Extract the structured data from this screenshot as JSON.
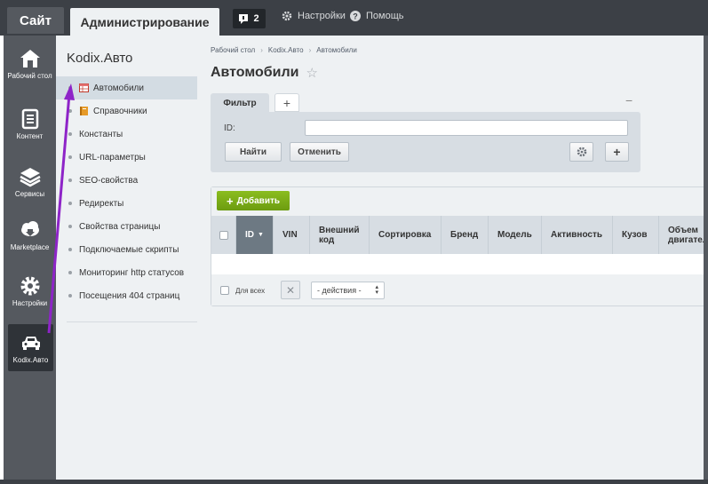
{
  "topbar": {
    "site_tab": "Сайт",
    "admin_tab": "Администрирование",
    "notifications_count": "2",
    "settings_label": "Настройки",
    "help_label": "Помощь"
  },
  "leftpanel": {
    "items": [
      {
        "label": "Рабочий стол",
        "icon": "home-icon"
      },
      {
        "label": "Контент",
        "icon": "document-icon"
      },
      {
        "label": "Сервисы",
        "icon": "layers-icon"
      },
      {
        "label": "Marketplace",
        "icon": "cloud-download-icon"
      },
      {
        "label": "Настройки",
        "icon": "gear-icon"
      },
      {
        "label": "Kodix.Авто",
        "icon": "car-icon"
      }
    ]
  },
  "menu": {
    "title": "Kodix.Авто",
    "items": [
      {
        "label": "Автомобили",
        "icon": "table-icon"
      },
      {
        "label": "Справочники",
        "icon": "book-icon"
      },
      {
        "label": "Константы"
      },
      {
        "label": "URL-параметры"
      },
      {
        "label": "SEO-свойства"
      },
      {
        "label": "Редиректы"
      },
      {
        "label": "Свойства страницы"
      },
      {
        "label": "Подключаемые скрипты"
      },
      {
        "label": "Мониторинг http статусов"
      },
      {
        "label": "Посещения 404 страниц"
      }
    ]
  },
  "breadcrumb": [
    "Рабочий стол",
    "Kodix.Авто",
    "Автомобили"
  ],
  "page": {
    "title": "Автомобили"
  },
  "filter": {
    "tab_label": "Фильтр",
    "add_tab": "+",
    "minimize": "−",
    "id_label": "ID:",
    "id_value": "",
    "find_button": "Найти",
    "cancel_button": "Отменить",
    "add_button": "+"
  },
  "grid": {
    "add_button": "Добавить",
    "columns": [
      "ID",
      "VIN",
      "Внешний код",
      "Сортировка",
      "Бренд",
      "Модель",
      "Активность",
      "Кузов",
      "Объем двигател"
    ],
    "select_all_label": "Для всех",
    "actions_select": "- действия -"
  },
  "colors": {
    "accent_green": "#7aac12",
    "annotation_arrow": "#8e24c8"
  }
}
